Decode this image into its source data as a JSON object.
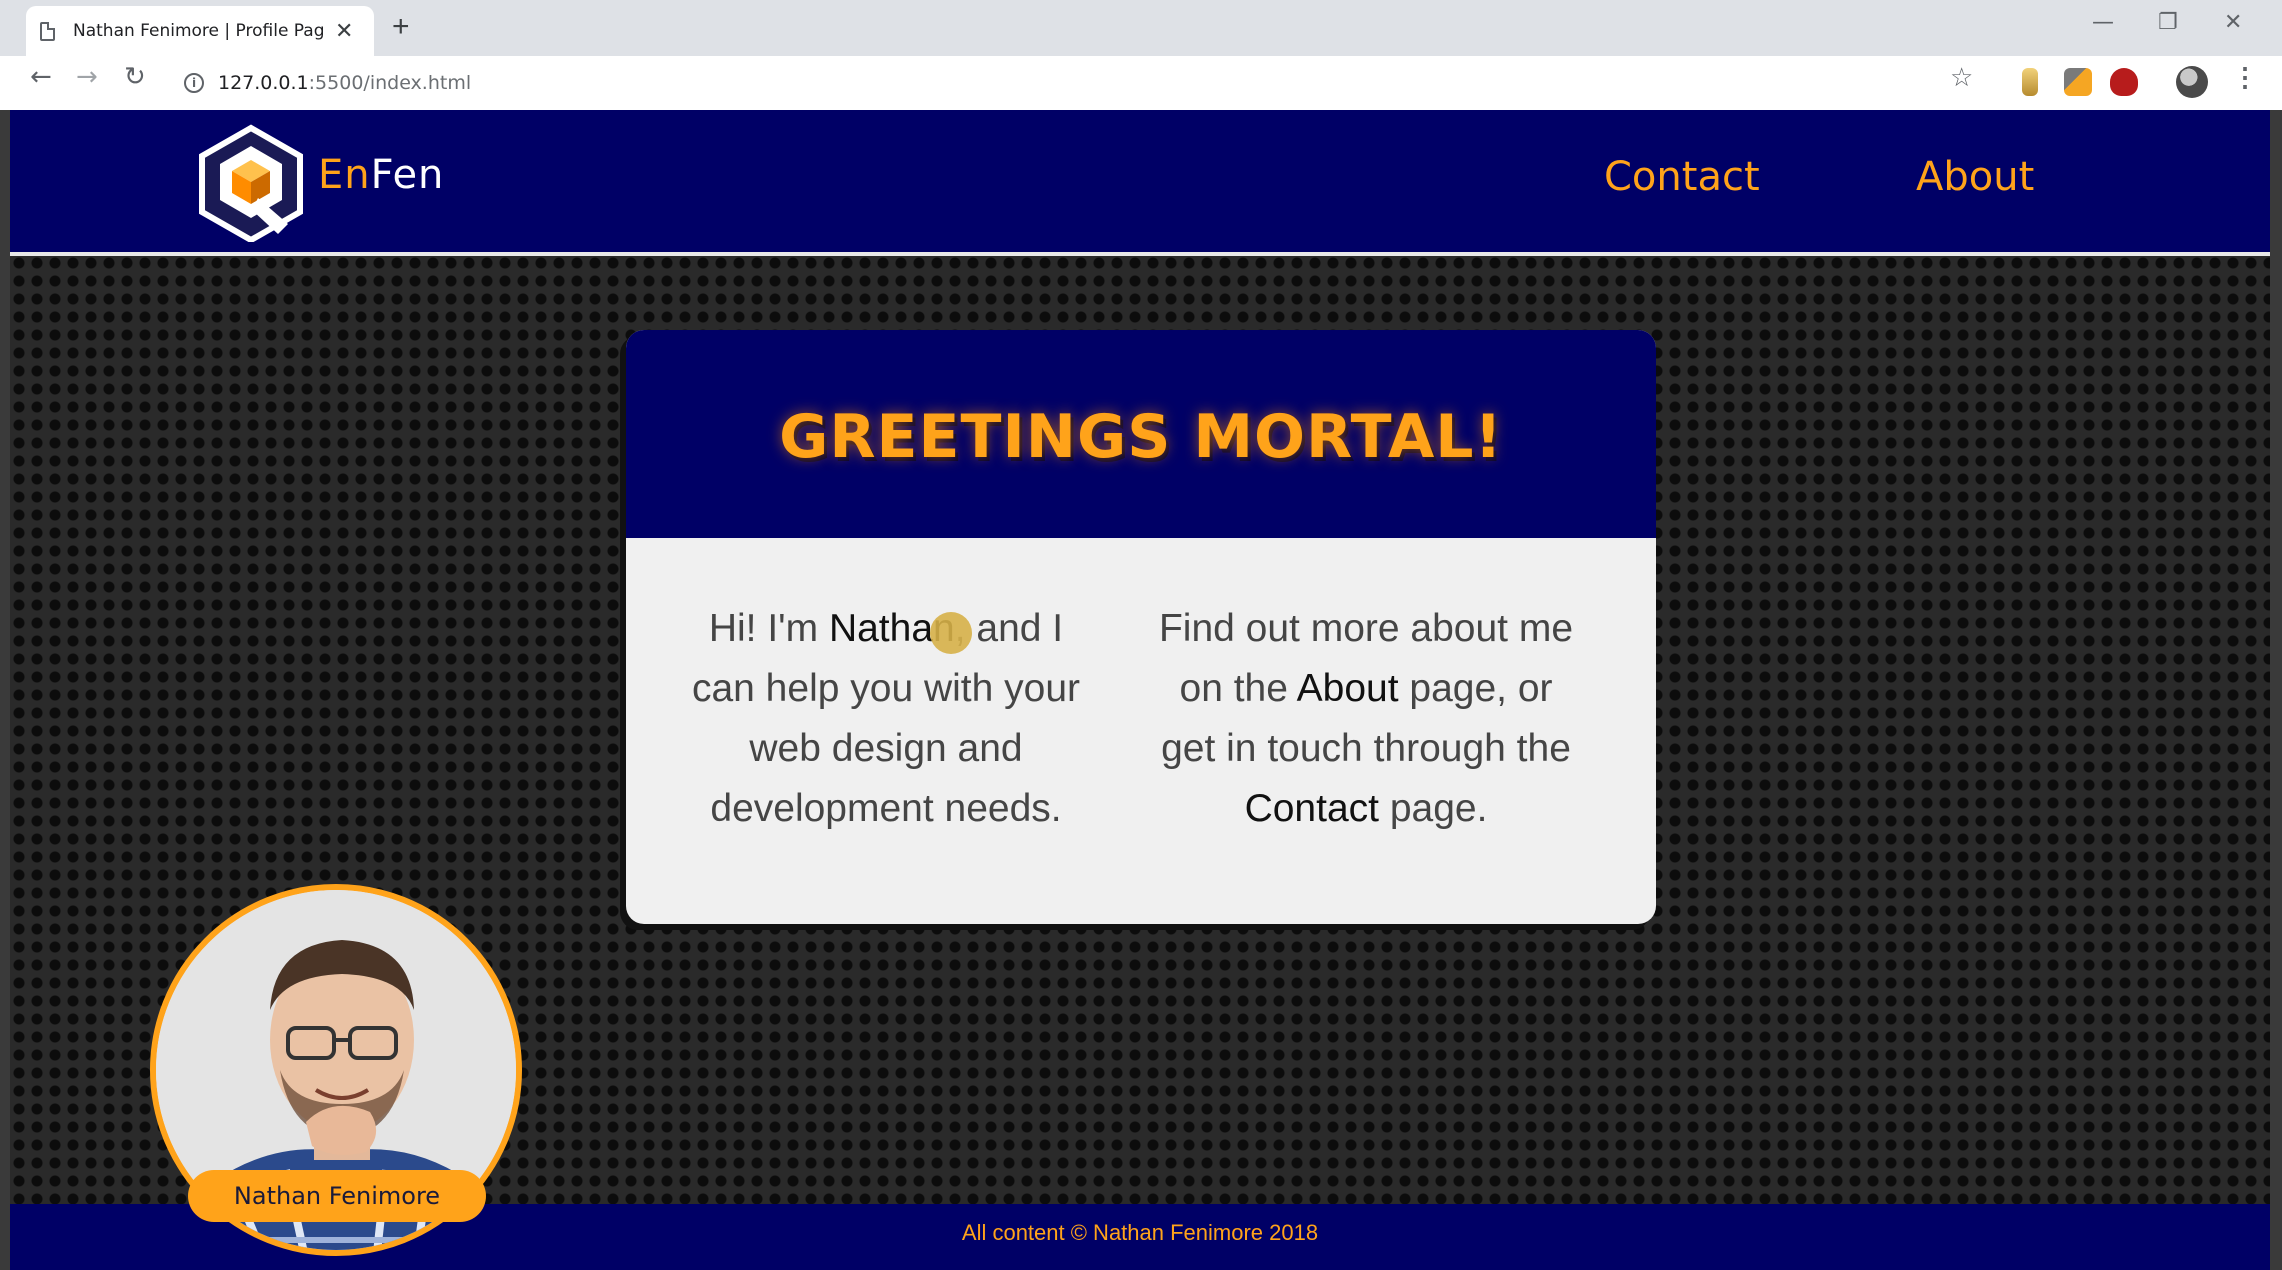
{
  "browser": {
    "tab_title": "Nathan Fenimore | Profile Page",
    "tab_close": "✕",
    "new_tab": "+",
    "url_host": "127.0.0.1",
    "url_rest": ":5500/index.html",
    "window_controls": {
      "minimize": "—",
      "maximize": "❐",
      "close": "✕"
    },
    "nav": {
      "back": "←",
      "forward": "→",
      "reload": "↻"
    },
    "star": "☆",
    "menu": "⋮"
  },
  "site": {
    "brand_en": "En",
    "brand_fen": "Fen",
    "nav": [
      {
        "label": "Contact"
      },
      {
        "label": "About"
      }
    ],
    "colors": {
      "navy": "#000066",
      "orange": "#ffa31a"
    }
  },
  "card": {
    "title": "GREETINGS MORTAL!",
    "left": {
      "before": "Hi! I'm ",
      "name": "Nathan",
      "after": ", and I can help you with your web design and development needs."
    },
    "right": {
      "before": "Find out more about me on the ",
      "about": "About",
      "middle": " page, or get in touch through the ",
      "contact": "Contact",
      "after": " page."
    }
  },
  "profile": {
    "name": "Nathan Fenimore"
  },
  "footer": {
    "copyright": "All content © Nathan Fenimore 2018"
  }
}
